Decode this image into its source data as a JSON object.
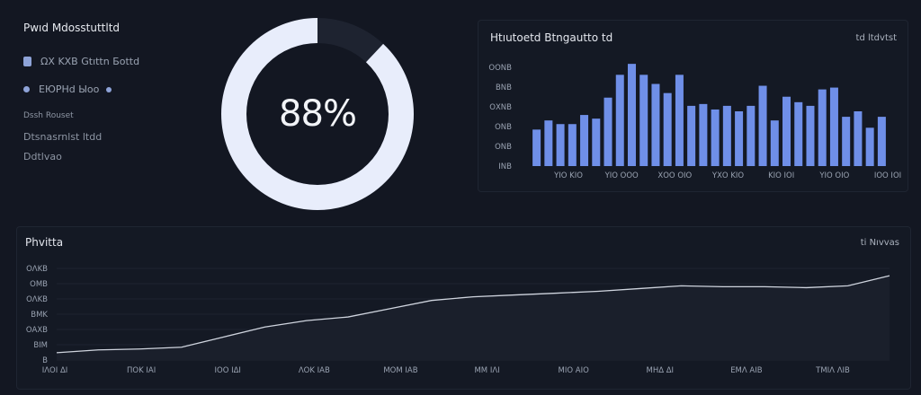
{
  "header": {
    "title": "Pwıd Мdosstuttltd"
  },
  "legend": {
    "items": [
      {
        "label": "ΩΧ ΚΧΒ Gtıttn Бottd",
        "color": "#8ea3d8"
      },
      {
        "label": "ЕЮΡΗd Ыoo",
        "color": "#8ea3d8"
      }
    ],
    "section_label": "Dssh Rouset",
    "info_lines": [
      "Dtsnasrnlst ltdd",
      "Ddtlvao"
    ]
  },
  "donut": {
    "value_text": "88%",
    "fraction": 0.88
  },
  "bar_panel": {
    "title": "Ηtıutoetd Btngautto td",
    "meta": "td ltdvtst",
    "y_ticks": [
      "ΟΟΝΒ",
      "ΒΝΒ",
      "ΟΧΝΒ",
      "ΟΝΒ",
      "ΟΝΒ",
      "ΙΝΒ"
    ],
    "x_ticks": [
      "ΥΙΟ ΚΙΟ",
      "ΥΙΟ ΟΟΟ",
      "ΧΟΟ ΟΙΟ",
      "ΥΧΟ ΚΙΟ",
      "ΚΙΟ ΙΟΙ",
      "ΥΙΟ ΟΙΟ",
      "ΙΟΟ ΙΟΙ"
    ]
  },
  "line_panel": {
    "title": "Ρhvitta",
    "meta": "ti Nıvvas",
    "y_ticks": [
      "ΟΛΚΒ",
      "ΟΜΒ",
      "ΟΛΚΒ",
      "ΒΜΚ",
      "ΟΑΧΒ",
      "ΒΙΜ",
      "Β"
    ],
    "x_ticks": [
      "ΙΛΟΙ ΔΙ",
      "ΠΟΚ ΙΑΙ",
      "ΙΟΟ ΙΔΙ",
      "ΛΟΚ ΙΑΒ",
      "ΜΟΜ ΙΑΒ",
      "ΜΜ ΙΛΙ",
      "ΜΙΟ ΑΙΟ",
      "ΜΗΔ ΔΙ",
      "ΕΜΛ ΑΙΒ",
      "ΤΜΙΛ ΛΙΒ"
    ]
  },
  "chart_data": [
    {
      "type": "bar",
      "title": "Ηtıutoetd Btngautto td",
      "xlabel": "",
      "ylabel": "",
      "ylim": [
        0,
        120
      ],
      "grid": false,
      "values": [
        40,
        50,
        46,
        46,
        56,
        52,
        75,
        100,
        112,
        100,
        90,
        80,
        100,
        66,
        68,
        62,
        66,
        60,
        66,
        88,
        50,
        76,
        70,
        66,
        84,
        86,
        54,
        60,
        42,
        54
      ]
    },
    {
      "type": "line",
      "title": "Ρhvitta",
      "xlabel": "",
      "ylabel": "",
      "ylim": [
        0,
        100
      ],
      "grid": true,
      "x": [
        0,
        1,
        2,
        3,
        4,
        5,
        6,
        7,
        8,
        9,
        10,
        11,
        12,
        13,
        14,
        15,
        16,
        17,
        18,
        19,
        20
      ],
      "values": [
        8,
        11,
        12,
        14,
        25,
        36,
        43,
        47,
        56,
        65,
        69,
        71,
        73,
        75,
        78,
        81,
        80,
        80,
        79,
        81,
        92
      ]
    }
  ],
  "colors": {
    "bar": "#6f8fe8",
    "line": "#cfd4de",
    "donut_fill": "#e8edfb",
    "donut_track": "#1e2330"
  }
}
